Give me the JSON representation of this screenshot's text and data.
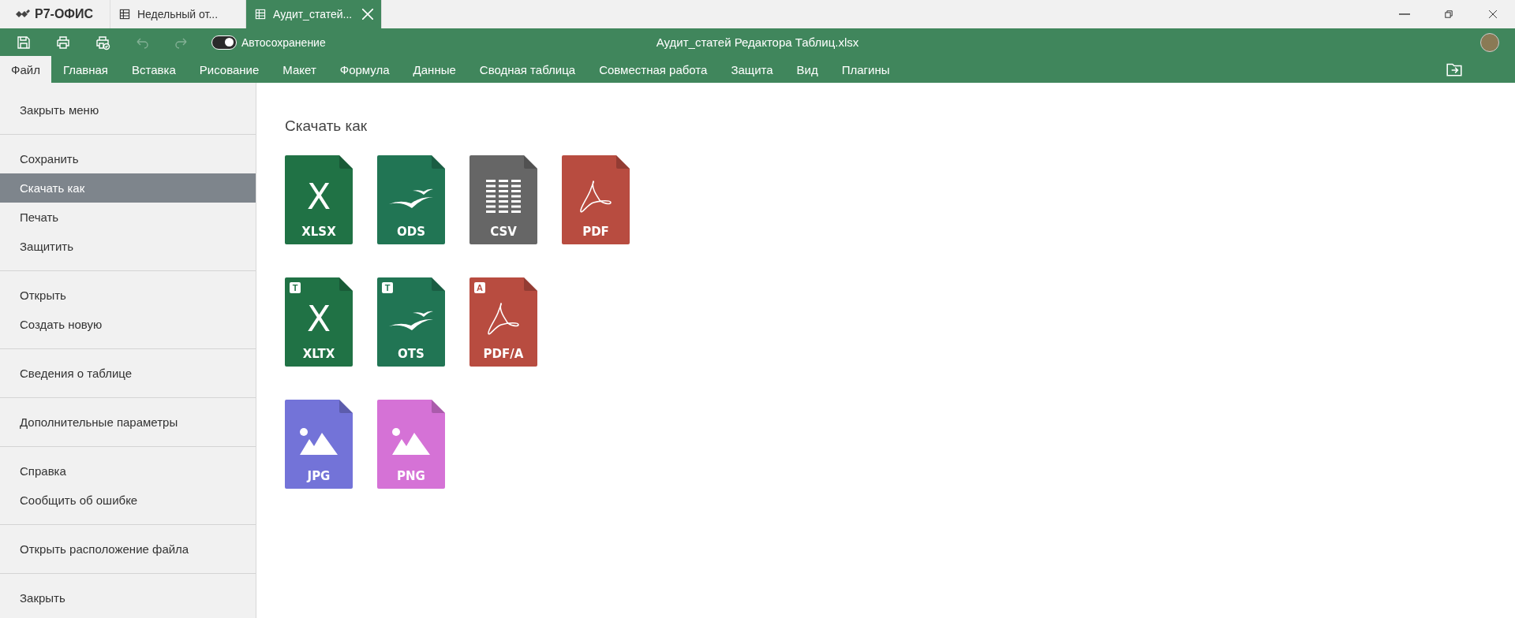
{
  "title_bar": {
    "brand": "Р7-ОФИС",
    "tabs": [
      {
        "label": "Недельный от...",
        "selected": false,
        "closable": false
      },
      {
        "label": "Аудит_статей...",
        "selected": true,
        "closable": true
      }
    ]
  },
  "toolbar": {
    "buttons": [
      {
        "kind": "save",
        "disabled": false
      },
      {
        "kind": "print",
        "disabled": false
      },
      {
        "kind": "quick-print",
        "disabled": false
      },
      {
        "kind": "undo",
        "disabled": true
      },
      {
        "kind": "redo",
        "disabled": true
      }
    ],
    "autosave": {
      "label": "Автосохранение",
      "on": true
    },
    "document_title": "Аудит_статей Редактора Таблиц.xlsx"
  },
  "ribbon_tabs": [
    {
      "label": "Файл",
      "selected": true
    },
    {
      "label": "Главная",
      "selected": false
    },
    {
      "label": "Вставка",
      "selected": false
    },
    {
      "label": "Рисование",
      "selected": false
    },
    {
      "label": "Макет",
      "selected": false
    },
    {
      "label": "Формула",
      "selected": false
    },
    {
      "label": "Данные",
      "selected": false
    },
    {
      "label": "Сводная таблица",
      "selected": false
    },
    {
      "label": "Совместная работа",
      "selected": false
    },
    {
      "label": "Защита",
      "selected": false
    },
    {
      "label": "Вид",
      "selected": false
    },
    {
      "label": "Плагины",
      "selected": false
    }
  ],
  "file_menu": [
    [
      {
        "label": "Закрыть меню",
        "selected": false
      }
    ],
    [
      {
        "label": "Сохранить",
        "selected": false
      },
      {
        "label": "Скачать как",
        "selected": true
      },
      {
        "label": "Печать",
        "selected": false
      },
      {
        "label": "Защитить",
        "selected": false
      }
    ],
    [
      {
        "label": "Открыть",
        "selected": false
      },
      {
        "label": "Создать новую",
        "selected": false
      }
    ],
    [
      {
        "label": "Сведения о таблице",
        "selected": false
      }
    ],
    [
      {
        "label": "Дополнительные параметры",
        "selected": false
      }
    ],
    [
      {
        "label": "Справка",
        "selected": false
      },
      {
        "label": "Сообщить об ошибке",
        "selected": false
      }
    ],
    [
      {
        "label": "Открыть расположение файла",
        "selected": false
      }
    ],
    [
      {
        "label": "Закрыть",
        "selected": false
      }
    ]
  ],
  "download_panel": {
    "title": "Скачать как",
    "rows": [
      [
        {
          "label": "XLSX",
          "kind": "letter",
          "glyph": "X",
          "color": "#207245"
        },
        {
          "label": "ODS",
          "kind": "gulls",
          "color": "#217554"
        },
        {
          "label": "CSV",
          "kind": "grid",
          "color": "#666666"
        },
        {
          "label": "PDF",
          "kind": "acrobat",
          "color": "#b84c40"
        }
      ],
      [
        {
          "label": "XLTX",
          "kind": "letter",
          "glyph": "X",
          "color": "#207245",
          "badge": "T"
        },
        {
          "label": "OTS",
          "kind": "gulls",
          "color": "#217554",
          "badge": "T"
        },
        {
          "label": "PDF/A",
          "kind": "acrobat",
          "color": "#b84c40",
          "badge": "A"
        }
      ],
      [
        {
          "label": "JPG",
          "kind": "image",
          "color": "#7373d8"
        },
        {
          "label": "PNG",
          "kind": "image",
          "color": "#d572d6"
        }
      ]
    ]
  }
}
